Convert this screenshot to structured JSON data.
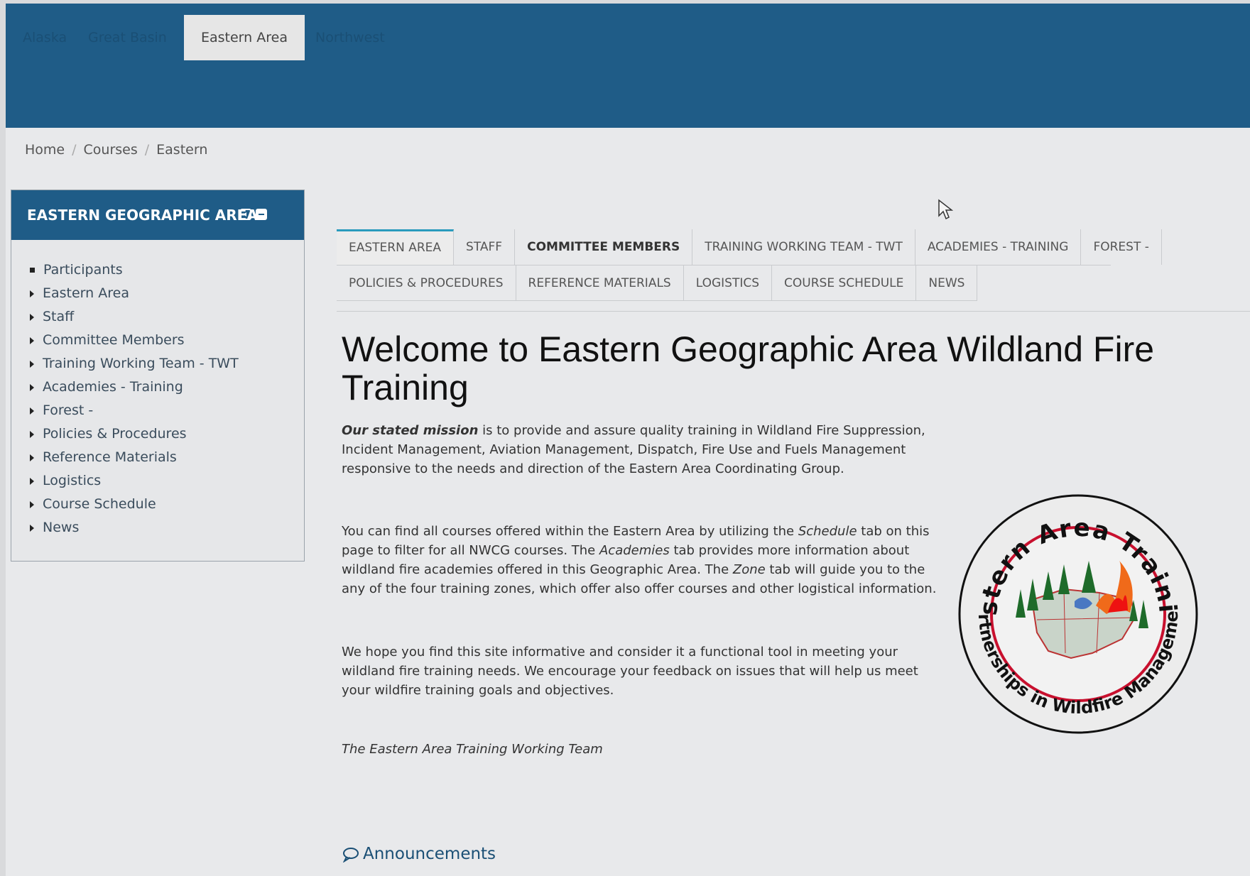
{
  "navbar": {
    "tabs": [
      {
        "label": "Alaska",
        "active": false
      },
      {
        "label": "Great Basin",
        "active": false
      },
      {
        "label": "Eastern Area",
        "active": true
      },
      {
        "label": "Northwest",
        "active": false
      }
    ]
  },
  "breadcrumb": [
    "Home",
    "Courses",
    "Eastern"
  ],
  "block": {
    "title": "EASTERN GEOGRAPHIC AREA",
    "items": [
      "Participants",
      "Eastern Area",
      "Staff",
      "Committee Members",
      "Training Working Team - TWT",
      "Academies - Training",
      "Forest -",
      "Policies & Procedures",
      "Reference Materials",
      "Logistics",
      "Course Schedule",
      "News"
    ]
  },
  "tabs": {
    "row1": [
      "Eastern Area",
      "Staff",
      "Committee Members",
      "Training Working Team - TWT",
      "Academies - Training",
      "Forest -"
    ],
    "row2": [
      "Policies & Procedures",
      "Reference Materials",
      "Logistics",
      "Course Schedule",
      "News"
    ]
  },
  "main": {
    "title": "Welcome to Eastern Geographic Area Wildland Fire Training",
    "p1_strong": "Our stated mission",
    "p1_rest": " is to provide and assure quality training in Wildland Fire Suppression, Incident Management, Aviation Management, Dispatch, Fire Use and Fuels Management responsive to the needs and direction of the Eastern Area Coordinating Group.",
    "p2_a": "You can find all courses offered within the Eastern Area by utilizing the ",
    "p2_b": "Schedule",
    "p2_c": " tab on this page to filter for all NWCG courses.  The ",
    "p2_d": "Academies",
    "p2_e": " tab provides more information about wildland fire academies offered in this Geographic Area.  The ",
    "p2_f": "Zone",
    "p2_g": " tab will guide you to the any of the four training zones, which offer also offer courses and other logistical information.",
    "p3": "We hope you find this site informative and consider it a functional tool in meeting your wildland fire training needs.  We encourage your feedback on issues that will help us meet your wildfire training goals and objectives.",
    "signature": "The Eastern Area Training Working Team",
    "announcements": "Announcements"
  },
  "logo": {
    "top_text": "Eastern Area Training",
    "bottom_text": "Partnerships in Wildfire Management"
  },
  "colors": {
    "navbar": "#1f5c87",
    "tab_accent": "#2a9bbd",
    "logo_ring": "#c8102e"
  },
  "icons": [
    "dock-icon",
    "collapse-icon",
    "chevron-right-icon",
    "announcements-icon",
    "mouse-cursor-icon"
  ]
}
